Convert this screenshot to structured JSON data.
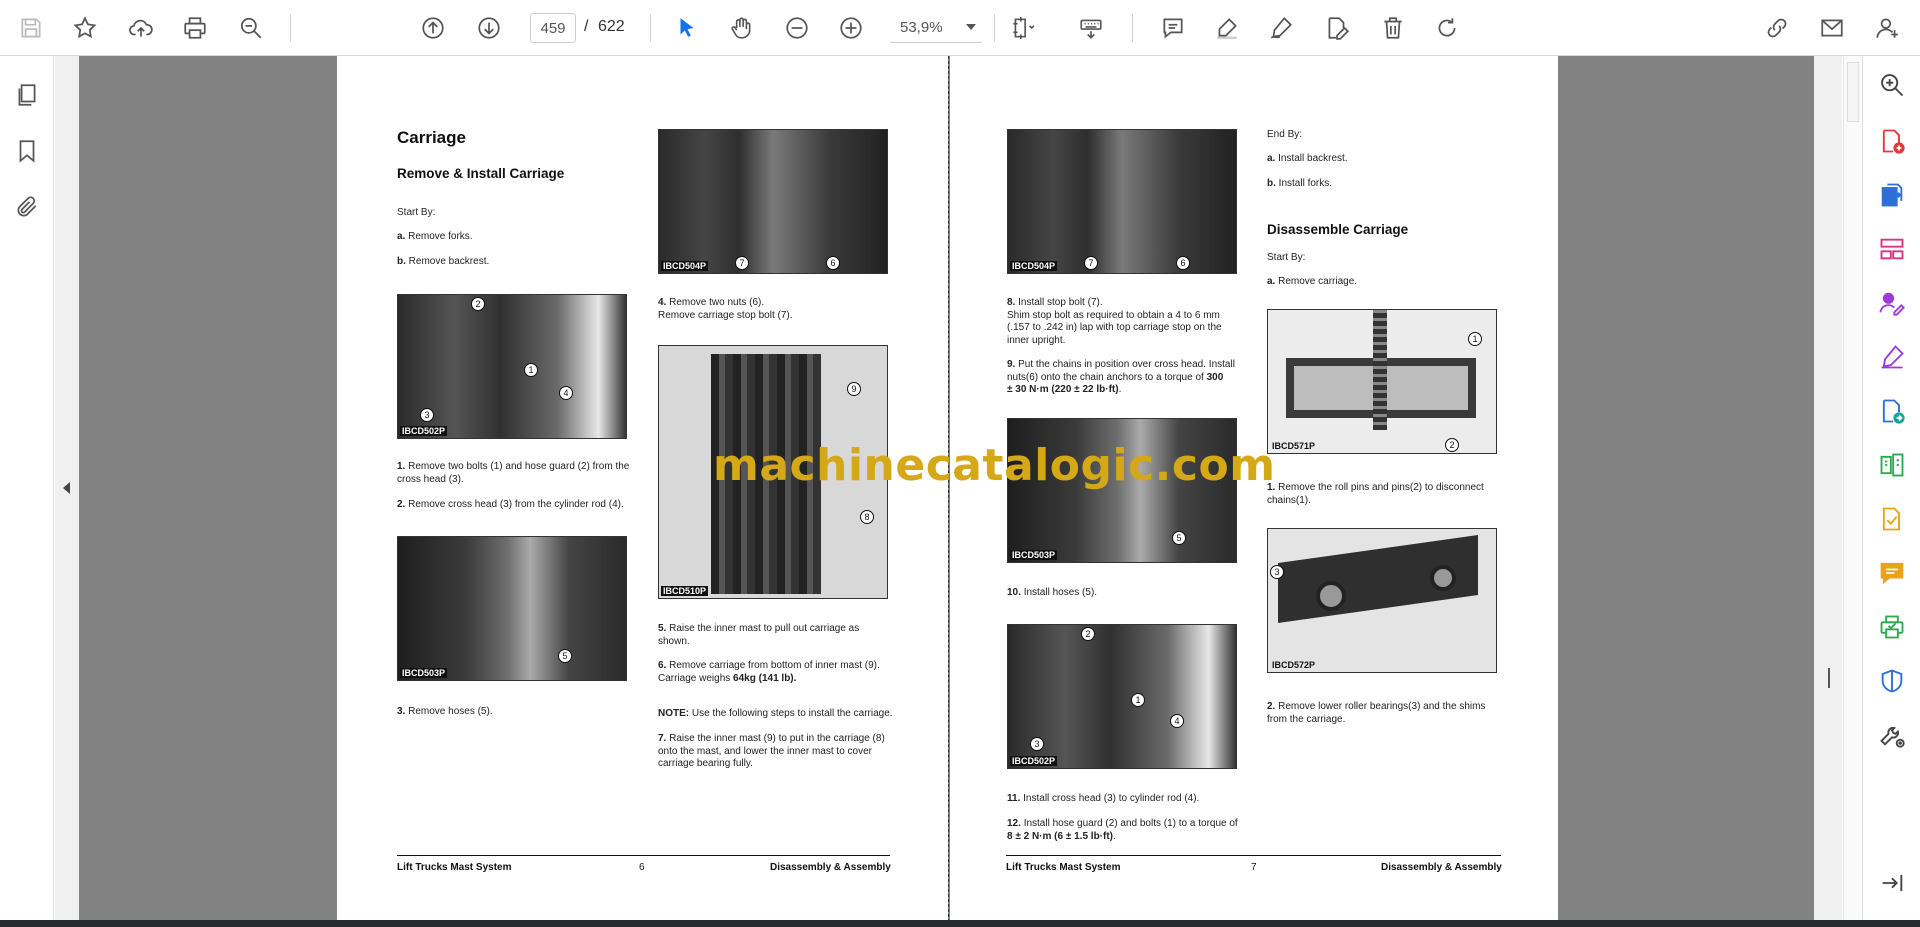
{
  "toolbar": {
    "page_current": "459",
    "page_separator": "/",
    "page_total": "622",
    "zoom": "53,9%"
  },
  "watermark": "machinecatalogic.com",
  "left_page": {
    "title": "Carriage",
    "subtitle": "Remove & Install Carriage",
    "start_by": "Start By:",
    "a_label": "a.",
    "a_text": "Remove forks.",
    "b_label": "b.",
    "b_text": "Remove backrest.",
    "step1_num": "1.",
    "step1": "Remove two bolts (1) and hose guard (2) from the\ncross head (3).",
    "step2_num": "2.",
    "step2": "Remove cross head (3) from the cylinder rod (4).",
    "step3_num": "3.",
    "step3": "Remove hoses (5).",
    "step4_num": "4.",
    "step4": "Remove two nuts (6).\nRemove carriage stop bolt (7).",
    "step5_num": "5.",
    "step5": "Raise the inner mast to pull out carriage as\nshown.",
    "step6_num": "6.",
    "step6_a": "Remove carriage from bottom of inner mast (9).\nCarriage weighs ",
    "step6_b": "64kg (141 lb).",
    "note_label": "NOTE:",
    "note": " Use the following steps to install the carriage.",
    "step7_num": "7.",
    "step7": "Raise the inner mast (9) to put in the carriage (8)\nonto the mast, and lower the inner mast to cover\ncarriage bearing fully.",
    "photo1_cap": "IBCD502P",
    "photo2_cap": "IBCD503P",
    "photo3_cap": "IBCD504P",
    "photo4_cap": "IBCD510P",
    "footer_left": "Lift Trucks Mast System",
    "footer_num": "6",
    "footer_right": "Disassembly & Assembly"
  },
  "right_page": {
    "step8_num": "8.",
    "step8": "Install stop bolt (7).\nShim stop bolt as required to obtain a 4 to 6 mm\n(.157 to .242 in) lap with top carriage stop on the\ninner upright.",
    "step9_num": "9.",
    "step9_a": "Put the chains in position over cross head. Install\nnuts(6) onto the chain anchors to a torque of ",
    "step9_b": "300\n± 30 N·m (220 ± 22 lb·ft)",
    "step9_c": ".",
    "step10_num": "10.",
    "step10": "Install hoses (5).",
    "step11_num": "11.",
    "step11": "Install cross head (3) to cylinder rod (4).",
    "step12_num": "12.",
    "step12_a": "Install hose guard (2) and bolts (1) to a torque of\n",
    "step12_b": "8 ± 2 N·m (6 ± 1.5 lb·ft)",
    "step12_c": ".",
    "end_by": "End By:",
    "ea_label": "a.",
    "ea_text": "Install backrest.",
    "eb_label": "b.",
    "eb_text": "Install forks.",
    "disassemble_title": "Disassemble Carriage",
    "d_start_by": "Start By:",
    "da_label": "a.",
    "da_text": "Remove carriage.",
    "d1_num": "1.",
    "d1": "Remove the roll pins and pins(2) to disconnect\nchains(1).",
    "d2_num": "2.",
    "d2": "Remove lower roller bearings(3) and the shims\nfrom the carriage.",
    "photo5_cap": "IBCD504P",
    "photo6_cap": "IBCD503P",
    "photo7_cap": "IBCD502P",
    "photo8_cap": "IBCD571P",
    "photo9_cap": "IBCD572P",
    "footer_left": "Lift Trucks Mast System",
    "footer_num": "7",
    "footer_right": "Disassembly & Assembly"
  },
  "callouts": {
    "c1": "1",
    "c2": "2",
    "c3": "3",
    "c4": "4",
    "c5": "5",
    "c6": "6",
    "c7": "7",
    "c8": "8",
    "c9": "9"
  }
}
